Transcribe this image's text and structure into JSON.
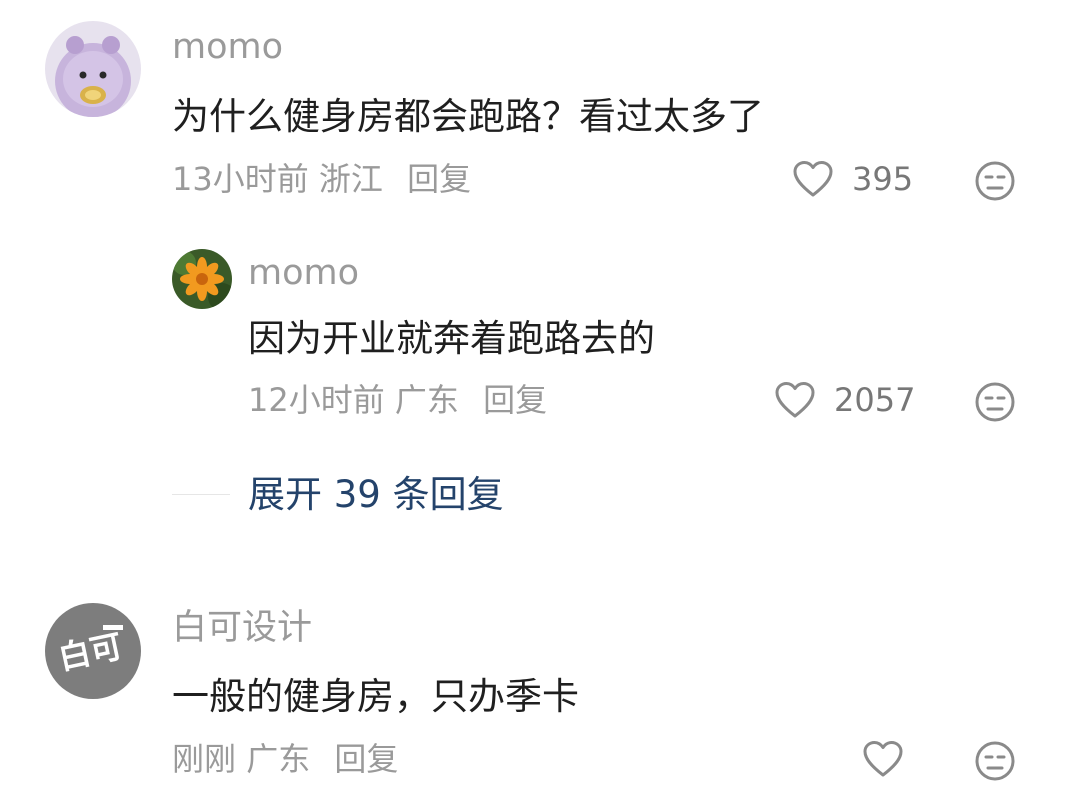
{
  "comments": [
    {
      "username": "momo",
      "text": "为什么健身房都会跑路？看过太多了",
      "time": "13小时前",
      "location": "浙江",
      "reply_label": "回复",
      "likes": "395",
      "avatar_icon": "purple-plush-toy-avatar"
    },
    {
      "username": "momo",
      "text": "因为开业就奔着跑路去的",
      "time": "12小时前",
      "location": "广东",
      "reply_label": "回复",
      "likes": "2057",
      "avatar_icon": "orange-flower-avatar"
    },
    {
      "username": "白可设计",
      "text": "一般的健身房，只办季卡",
      "time": "刚刚",
      "location": "广东",
      "reply_label": "回复",
      "likes": "",
      "avatar_icon": "baike-logo-avatar",
      "avatar_text": "白可"
    }
  ],
  "expand_replies": "展开 39 条回复",
  "colors": {
    "username": "#9a9a9a",
    "content": "#1f1f1f",
    "expand_link": "#24436b",
    "icon": "#8a8a8a"
  }
}
